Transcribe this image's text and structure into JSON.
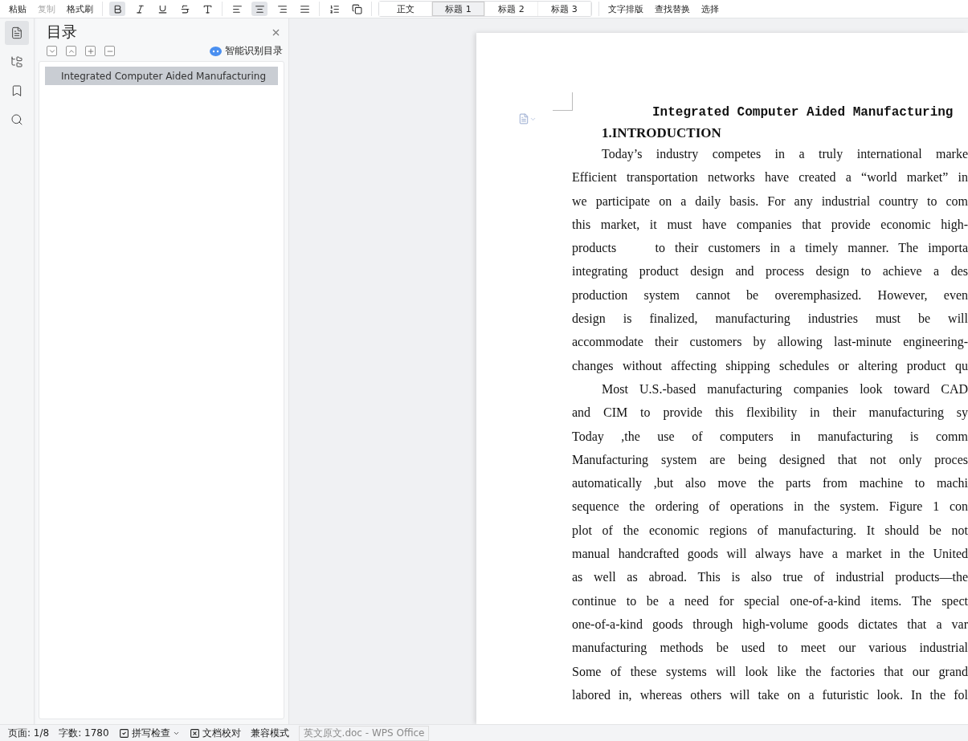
{
  "toolbar": {
    "clipboard": [
      {
        "label": "粘贴",
        "disabled": false
      },
      {
        "label": "复制",
        "disabled": true
      },
      {
        "label": "格式刷",
        "disabled": false
      }
    ],
    "styles": [
      {
        "label": "正文",
        "selected": false
      },
      {
        "label": "标题 1",
        "selected": true
      },
      {
        "label": "标题 2",
        "selected": false
      },
      {
        "label": "标题 3",
        "selected": false
      }
    ],
    "tools": [
      "文字排版",
      "查找替换",
      "选择"
    ]
  },
  "side_rail": [
    {
      "kind": "outline",
      "selected": true
    },
    {
      "kind": "tree",
      "selected": false
    },
    {
      "kind": "bookmark",
      "selected": false
    },
    {
      "kind": "search",
      "selected": false
    }
  ],
  "toc_panel": {
    "title": "目录",
    "smart_button": "智能识别目录",
    "items": [
      {
        "label": "Integrated Computer Aided Manufacturing",
        "selected": true
      }
    ]
  },
  "document": {
    "title": "Integrated Computer Aided Manufacturing",
    "heading": "1.INTRODUCTION",
    "paragraphs": [
      [
        "Today’s industry competes in a truly international marke",
        "Efficient transportation networks have created a “world market” in",
        "we participate on a daily basis. For any industrial country to com",
        "this market, it must have companies that provide economic high-",
        "products    to their customers in a timely manner. The importa",
        "integrating product design and process design to achieve a des",
        "production system cannot be overemphasized. However, even",
        "design is finalized, manufacturing industries must be will",
        "accommodate their customers by allowing last-minute engineering-",
        "changes without affecting shipping schedules or altering product qu"
      ],
      [
        "Most U.S.-based manufacturing companies look toward CAD",
        "and CIM to provide this flexibility in their manufacturing sy",
        "Today ,the use of computers in manufacturing is comm",
        "Manufacturing system are being designed that not only proces",
        "automatically ,but also move the parts from machine to machi",
        "sequence the ordering of operations in the system. Figure 1 con",
        "plot of the economic regions of manufacturing. It should be not",
        "manual handcrafted goods will always have a market in the United",
        "as well as abroad. This is also true of industrial products—the",
        "continue to be a need for special one-of-a-kind items. The spect",
        "one-of-a-kind goods through high-volume goods dictates that a var",
        "manufacturing methods be used to meet our various industrial",
        "Some of these systems will look like the factories that our grand",
        "labored in, whereas others will take on a futuristic look. In the fol"
      ]
    ]
  },
  "status_bar": {
    "page": "页面: 1/8",
    "words": "字数: 1780",
    "spell_check": "拼写检查",
    "proofread": "文档校对",
    "mode": "兼容模式",
    "window_title": "英文原文.doc - WPS Office"
  }
}
